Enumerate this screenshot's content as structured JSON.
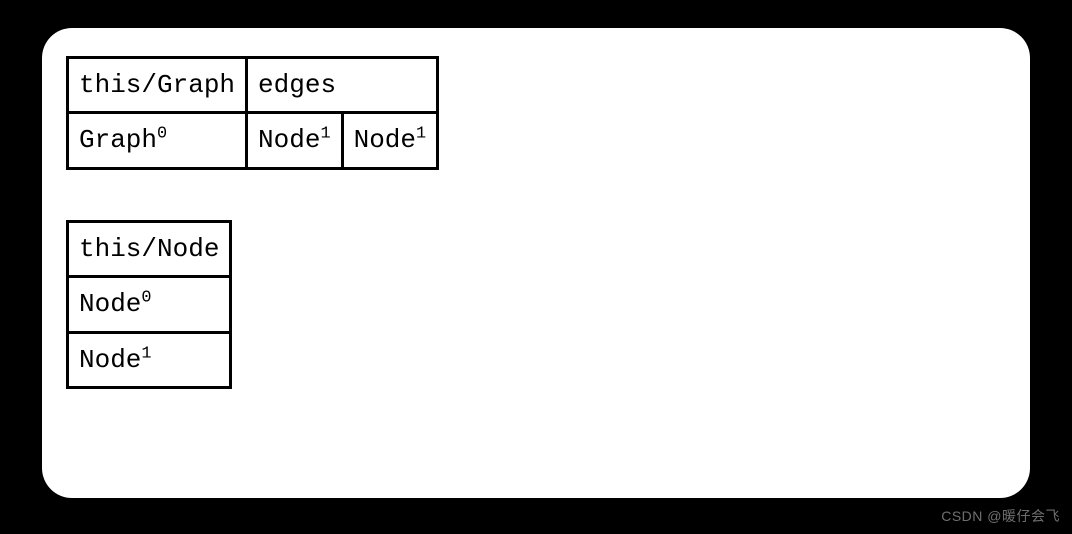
{
  "table1": {
    "header": {
      "c1": "this/Graph",
      "c2": "edges"
    },
    "row": {
      "c1_base": "Graph",
      "c1_sup": "0",
      "c2_base": "Node",
      "c2_sup": "1",
      "c3_base": "Node",
      "c3_sup": "1"
    }
  },
  "table2": {
    "header": "this/Node",
    "rows": [
      {
        "base": "Node",
        "sup": "0"
      },
      {
        "base": "Node",
        "sup": "1"
      }
    ]
  },
  "watermark": "CSDN @暖仔会飞"
}
